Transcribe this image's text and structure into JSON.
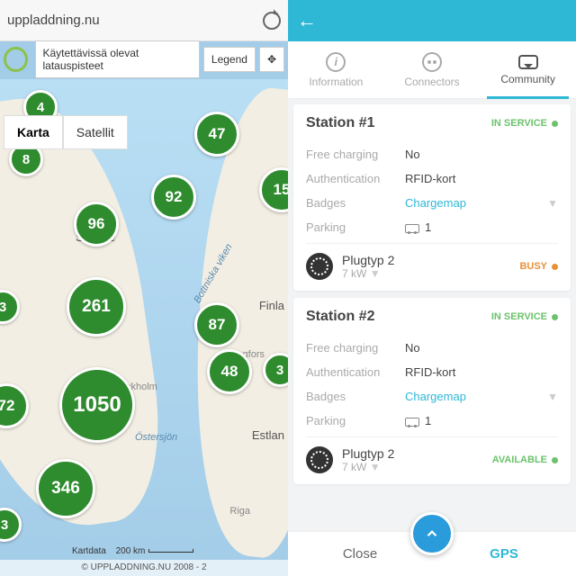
{
  "browser": {
    "url": "uppladdning.nu"
  },
  "legend": {
    "filter": "Käytettävissä olevat latauspisteet",
    "legend": "Legend"
  },
  "map_controls": {
    "map": "Karta",
    "sat": "Satellit"
  },
  "labels": {
    "sverige": "Sverige",
    "finland": "Finla",
    "bottniska": "Bottniska viken",
    "ostersjon": "Östersjön",
    "estland": "Estlan",
    "riga": "Riga",
    "stockholm": "ckholm",
    "ngfors": "ngfors"
  },
  "markers": {
    "a": "4",
    "b": "47",
    "c": "8",
    "d": "92",
    "e": "15",
    "f": "96",
    "g": "261",
    "h": "3",
    "i": "87",
    "j": "48",
    "k": "3",
    "l": "72",
    "m": "1050",
    "n": "346",
    "o": "3"
  },
  "footer": {
    "copyright": "© UPPLADDNING.NU 2008 - 2",
    "kartdata": "Kartdata",
    "scale": "200 km"
  },
  "tabs": {
    "info": "Information",
    "conn": "Connectors",
    "comm": "Community"
  },
  "stations": [
    {
      "title": "Station #1",
      "status": "IN SERVICE",
      "free_charging_label": "Free charging",
      "free_charging": "No",
      "auth_label": "Authentication",
      "auth": "RFID-kort",
      "badges_label": "Badges",
      "badges": "Chargemap",
      "parking_label": "Parking",
      "parking": "1",
      "plug_name": "Plugtyp 2",
      "plug_power": "7 kW",
      "plug_status": "BUSY"
    },
    {
      "title": "Station #2",
      "status": "IN SERVICE",
      "free_charging_label": "Free charging",
      "free_charging": "No",
      "auth_label": "Authentication",
      "auth": "RFID-kort",
      "badges_label": "Badges",
      "badges": "Chargemap",
      "parking_label": "Parking",
      "parking": "1",
      "plug_name": "Plugtyp 2",
      "plug_power": "7 kW",
      "plug_status": "AVAILABLE"
    }
  ],
  "bottom": {
    "close": "Close",
    "gps": "GPS"
  }
}
